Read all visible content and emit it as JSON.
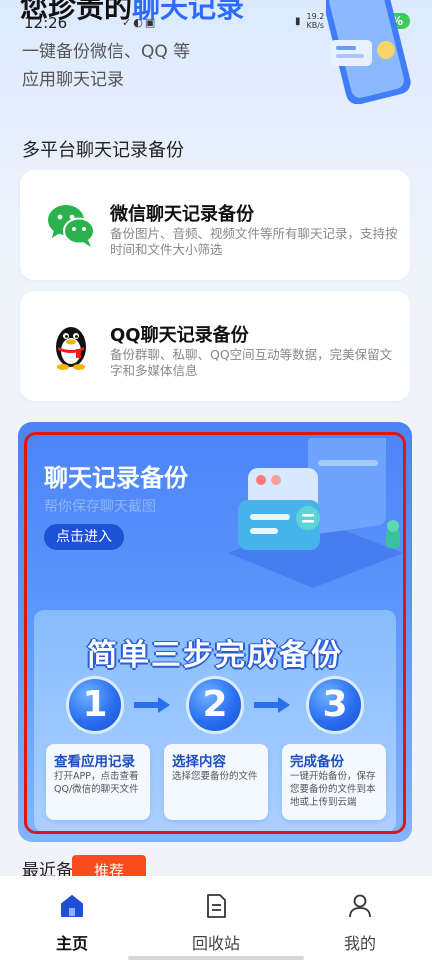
{
  "status_bar": {
    "time": "12:26",
    "net_speed_value": "19.2",
    "net_speed_unit": "KB/s",
    "battery": "25%"
  },
  "hero": {
    "title_prefix": "您珍贵的",
    "title_highlight": "聊天记录",
    "subtitle": "一键备份微信、QQ 等应用聊天记录"
  },
  "section": {
    "title": "多平台聊天记录备份"
  },
  "cards": [
    {
      "title": "微信聊天记录备份",
      "desc": "备份图片、音频、视频文件等所有聊天记录，支持按时间和文件大小筛选",
      "icon": "wechat-icon"
    },
    {
      "title": "QQ聊天记录备份",
      "desc": "备份群聊、私聊、QQ空间互动等数据，完美保留文字和多媒体信息",
      "icon": "qq-penguin-icon"
    }
  ],
  "banner": {
    "title": "聊天记录备份",
    "subtitle": "帮你保存聊天截图",
    "button": "点击进入",
    "steps_title": "简单三步完成备份",
    "steps": [
      {
        "num": "1",
        "title": "查看应用记录",
        "desc": "打开APP，点击查看QQ/微信的聊天文件"
      },
      {
        "num": "2",
        "title": "选择内容",
        "desc": "选择您要备份的文件"
      },
      {
        "num": "3",
        "title": "完成备份",
        "desc": "一键开始备份，保存您要备份的文件到本地或上传到云端"
      }
    ]
  },
  "recent": {
    "label": "最近备",
    "badge": "推荐"
  },
  "tabbar": {
    "items": [
      {
        "label": "主页",
        "icon": "home-icon",
        "active": true
      },
      {
        "label": "回收站",
        "icon": "recycle-bin-icon",
        "active": false
      },
      {
        "label": "我的",
        "icon": "profile-icon",
        "active": false
      }
    ]
  },
  "colors": {
    "accent": "#2d6bff",
    "banner": "#4c84f7",
    "badge": "#f84b1e",
    "battery": "#3ccb59",
    "highlight_border": "#e01515"
  }
}
